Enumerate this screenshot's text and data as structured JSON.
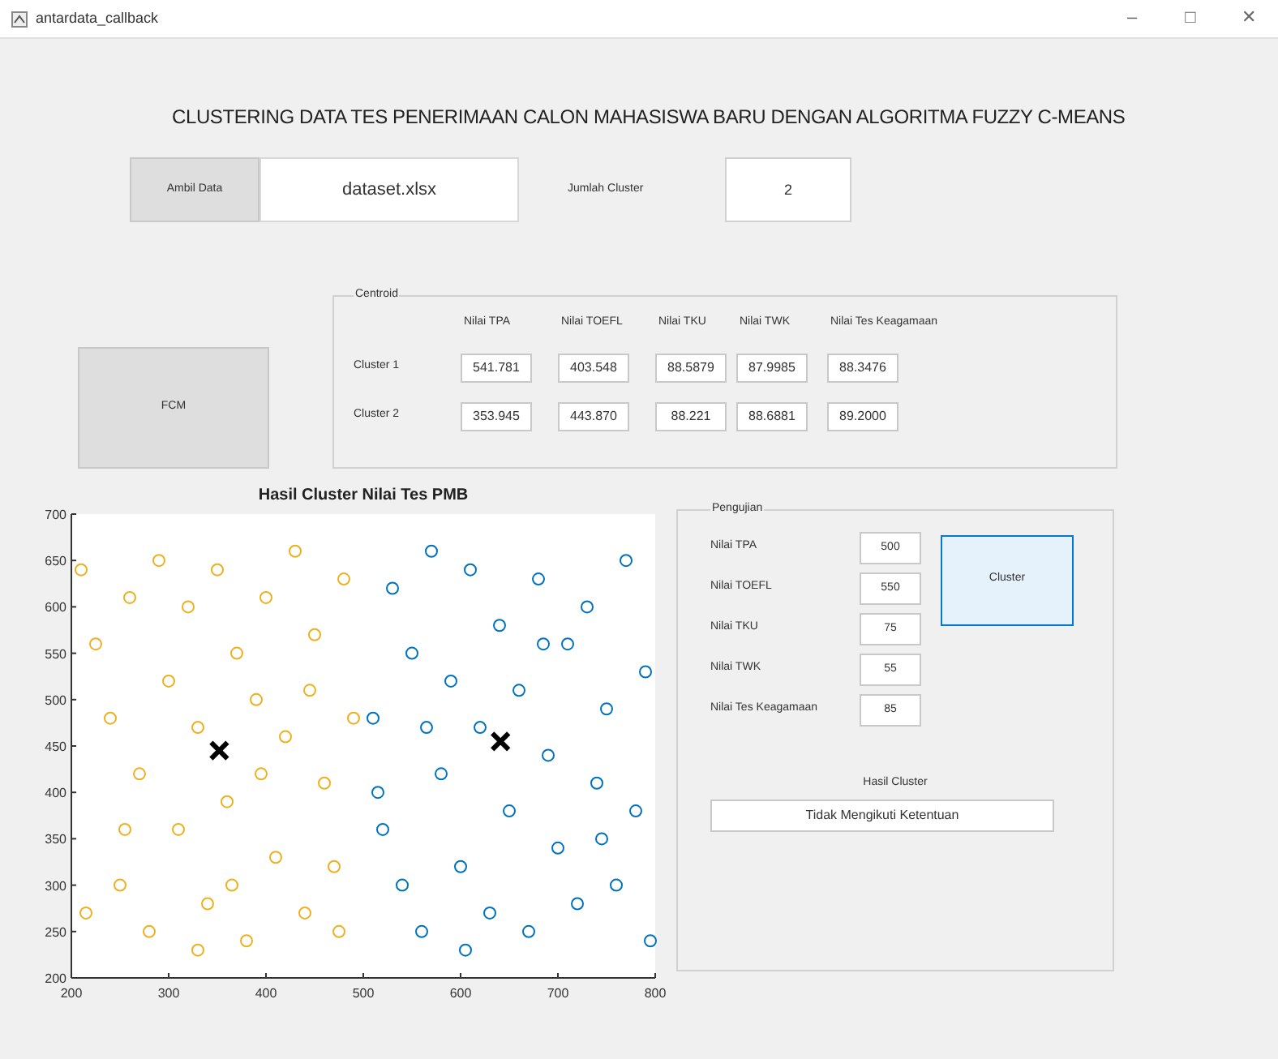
{
  "window": {
    "title": "antardata_callback",
    "controls": [
      "–",
      "□",
      "✕"
    ]
  },
  "heading": "CLUSTERING DATA TES PENERIMAAN CALON MAHASISWA BARU DENGAN ALGORITMA FUZZY C-MEANS",
  "load_button": "Ambil Data",
  "file_field": {
    "value": "dataset.xlsx"
  },
  "cluster_count": {
    "label": "Jumlah Cluster",
    "value": "2"
  },
  "fcm_button": "FCM",
  "centroid_panel": {
    "title": "Centroid",
    "columns": [
      "Nilai TPA",
      "Nilai TOEFL",
      "Nilai TKU",
      "Nilai TWK",
      "Nilai Tes Keagamaan"
    ],
    "rows": [
      {
        "label": "Cluster 1",
        "values": [
          "541.781",
          "403.548",
          "88.5879",
          "87.9985",
          "88.3476"
        ]
      },
      {
        "label": "Cluster 2",
        "values": [
          "353.945",
          "443.870",
          "88.221",
          "88.6881",
          "89.2000"
        ]
      }
    ]
  },
  "plot": {
    "chart_data": {
      "type": "scatter",
      "title": "Hasil Cluster Nilai Tes PMB",
      "xlim": [
        200,
        800
      ],
      "ylim": [
        200,
        700
      ],
      "xticks": [
        200,
        300,
        400,
        500,
        600,
        700,
        800
      ],
      "yticks": [
        200,
        250,
        300,
        350,
        400,
        450,
        500,
        550,
        600,
        650,
        700
      ],
      "series": [
        {
          "color": "#edb120",
          "marker": "o",
          "x": [
            210,
            225,
            240,
            250,
            260,
            270,
            280,
            290,
            300,
            310,
            320,
            330,
            340,
            350,
            360,
            370,
            380,
            390,
            400,
            410,
            420,
            430,
            440,
            450,
            460,
            470,
            480,
            490,
            255,
            330,
            395,
            445,
            215,
            365,
            475
          ],
          "values": [
            640,
            560,
            480,
            300,
            610,
            420,
            250,
            650,
            520,
            360,
            600,
            470,
            280,
            640,
            390,
            550,
            240,
            500,
            610,
            330,
            460,
            660,
            270,
            570,
            410,
            320,
            630,
            480,
            360,
            230,
            420,
            510,
            270,
            300,
            250
          ]
        },
        {
          "color": "#0072bd",
          "marker": "o",
          "x": [
            510,
            520,
            530,
            540,
            550,
            560,
            570,
            580,
            590,
            600,
            610,
            620,
            630,
            640,
            650,
            660,
            670,
            680,
            690,
            700,
            710,
            720,
            730,
            740,
            750,
            760,
            770,
            780,
            790,
            795,
            515,
            605,
            685,
            745,
            565
          ],
          "values": [
            480,
            360,
            620,
            300,
            550,
            250,
            660,
            420,
            520,
            320,
            640,
            470,
            270,
            580,
            380,
            510,
            250,
            630,
            440,
            340,
            560,
            280,
            600,
            410,
            490,
            300,
            650,
            380,
            530,
            240,
            400,
            230,
            560,
            350,
            470
          ]
        },
        {
          "color": "#000000",
          "marker": "x",
          "x": [
            352,
            641
          ],
          "values": [
            445,
            455
          ]
        }
      ]
    }
  },
  "test_panel": {
    "title": "Pengujian",
    "fields": [
      {
        "label": "Nilai TPA",
        "value": "500"
      },
      {
        "label": "Nilai TOEFL",
        "value": "550"
      },
      {
        "label": "Nilai TKU",
        "value": "75"
      },
      {
        "label": "Nilai TWK",
        "value": "55"
      },
      {
        "label": "Nilai Tes Keagamaan",
        "value": "85"
      }
    ],
    "cluster_button": "Cluster",
    "result_label": "Hasil Cluster",
    "result": "Tidak Mengikuti Ketentuan"
  }
}
